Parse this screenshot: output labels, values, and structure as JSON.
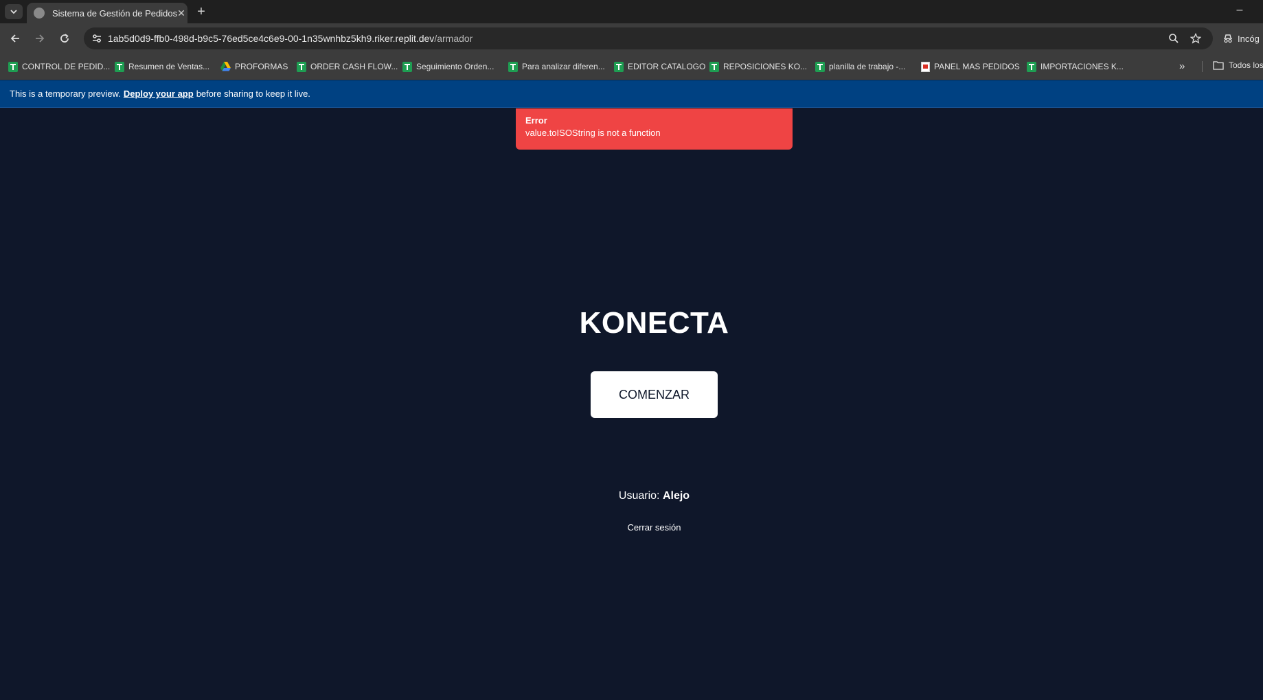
{
  "browser": {
    "tab_title": "Sistema de Gestión de Pedidos",
    "url_host": "1ab5d0d9-ffb0-498d-b9c5-76ed5ce4c6e9-00-1n35wnhbz5kh9.riker.replit.dev",
    "url_path": "/armador",
    "profile_label": "Incóg",
    "bookmarks": [
      {
        "label": "CONTROL DE PEDID...",
        "icon": "sheets-icon"
      },
      {
        "label": "Resumen de Ventas...",
        "icon": "sheets-icon"
      },
      {
        "label": "PROFORMAS",
        "icon": "drive-icon"
      },
      {
        "label": "ORDER CASH FLOW...",
        "icon": "sheets-icon"
      },
      {
        "label": "Seguimiento Orden...",
        "icon": "sheets-icon"
      },
      {
        "label": "Para analizar diferen...",
        "icon": "sheets-icon"
      },
      {
        "label": "EDITOR CATALOGO",
        "icon": "sheets-icon"
      },
      {
        "label": "REPOSICIONES KO...",
        "icon": "sheets-icon"
      },
      {
        "label": "planilla de trabajo -...",
        "icon": "sheets-icon"
      },
      {
        "label": "PANEL MAS PEDIDOS",
        "icon": "doc-icon"
      },
      {
        "label": "IMPORTACIONES K...",
        "icon": "sheets-icon"
      }
    ],
    "bookmarks_folder": "Todos los"
  },
  "banner": {
    "prefix": "This is a temporary preview.",
    "link": "Deploy your app",
    "suffix": "before sharing to keep it live."
  },
  "toast": {
    "title": "Error",
    "message": "value.toISOString is not a function",
    "color": "#ef4444"
  },
  "main": {
    "brand": "KONECTA",
    "start_button": "COMENZAR",
    "user_label": "Usuario:",
    "user_name": "Alejo",
    "logout": "Cerrar sesión",
    "background": "#0f172a"
  }
}
